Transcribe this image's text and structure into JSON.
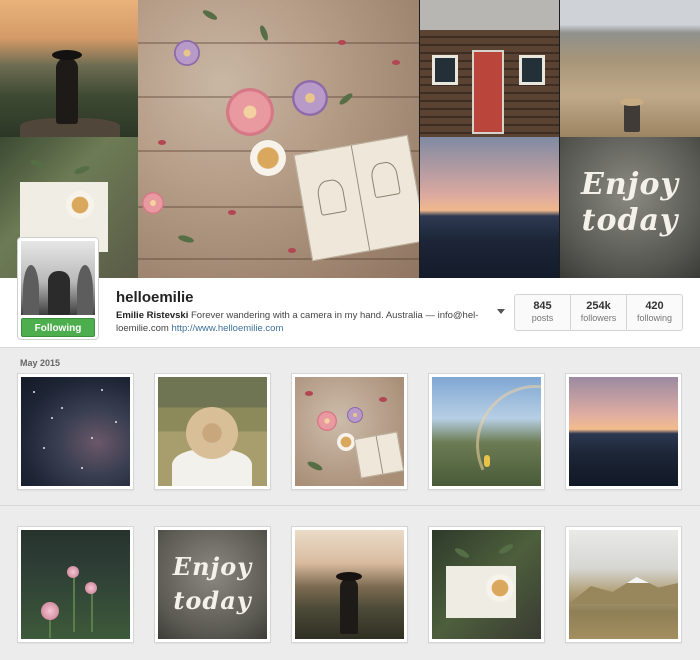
{
  "profile": {
    "username": "helloemilie",
    "follow_label": "Following",
    "full_name": "Emilie Ristevski",
    "bio_text": " Forever wandering with a camera in my hand. Australia — info@hel-loemilie.com ",
    "website": "http://www.helloemilie.com",
    "stats": [
      {
        "value": "845",
        "label": "posts"
      },
      {
        "value": "254k",
        "label": "followers"
      },
      {
        "value": "420",
        "label": "following"
      }
    ]
  },
  "hero": {
    "enjoy_line1": "Enjoy",
    "enjoy_line2": "today"
  },
  "grid": {
    "section_label": "May 2015",
    "row2_enjoy_line1": "Enjoy",
    "row2_enjoy_line2": "today"
  },
  "colors": {
    "following_button": "#4cae4c",
    "link": "#3f729b",
    "background": "#ececec"
  },
  "icons": {
    "dropdown": "chevron-down-icon"
  }
}
